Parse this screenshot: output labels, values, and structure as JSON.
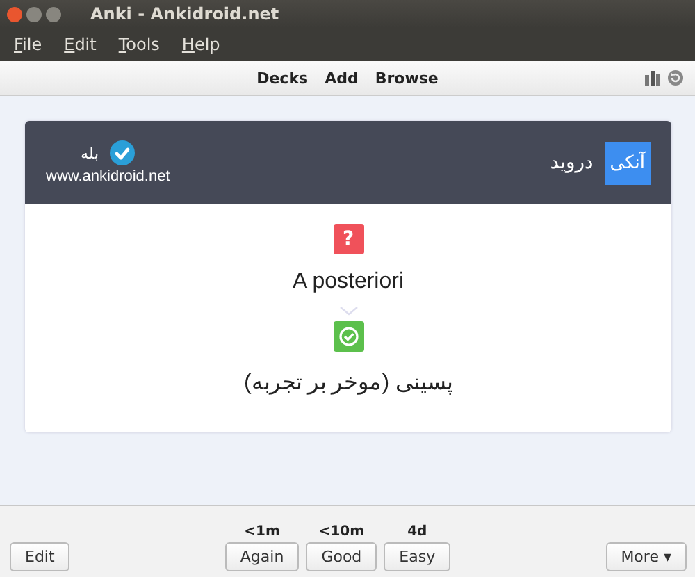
{
  "window": {
    "title": "Anki - Ankidroid.net"
  },
  "menu": [
    "File",
    "Edit",
    "Tools",
    "Help"
  ],
  "toolbar": {
    "links": [
      "Decks",
      "Add",
      "Browse"
    ]
  },
  "card": {
    "header": {
      "badge": "آنکی",
      "brand": "دروید",
      "approved": "بله",
      "url": "www.ankidroid.net"
    },
    "question_mark": "?",
    "front": "A posteriori",
    "back": "پسینی (موخر بر تجربه)"
  },
  "footer": {
    "edit": "Edit",
    "answers": [
      {
        "time": "<1m",
        "label": "Again"
      },
      {
        "time": "<10m",
        "label": "Good"
      },
      {
        "time": "4d",
        "label": "Easy"
      }
    ],
    "more": "More ▾"
  }
}
